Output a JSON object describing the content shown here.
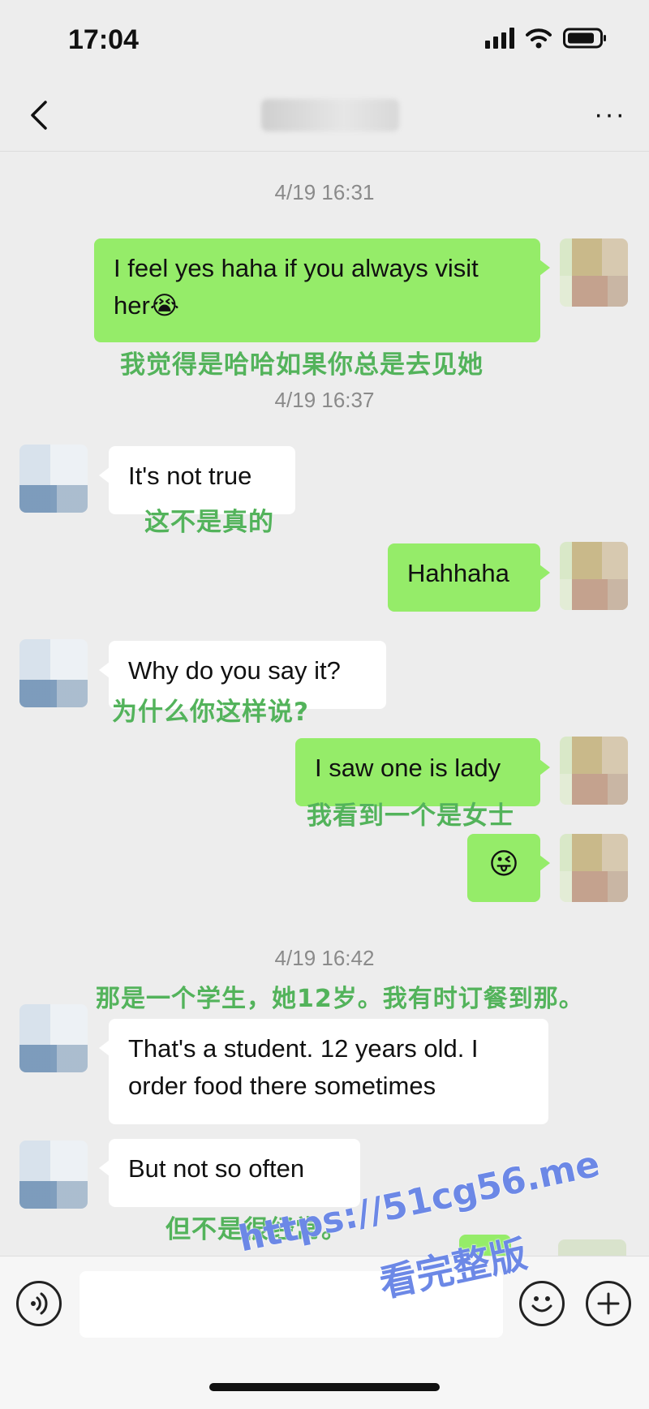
{
  "status": {
    "time": "17:04"
  },
  "nav": {
    "back_icon": "chevron-left-icon",
    "more_label": "···"
  },
  "messages": [
    {
      "timestamp": "4/19 16:31"
    },
    {
      "side": "right",
      "text_line1": "I feel yes haha if you always visit",
      "text_line2": "her😭",
      "translation": "我觉得是哈哈如果你总是去见她"
    },
    {
      "timestamp": "4/19 16:37"
    },
    {
      "side": "left",
      "text": "It's not true",
      "translation": "这不是真的"
    },
    {
      "side": "right",
      "text": "Hahhaha"
    },
    {
      "side": "left",
      "text": "Why do you say it?",
      "translation": "为什么你这样说?"
    },
    {
      "side": "right",
      "text": "I saw one is lady",
      "translation": "我看到一个是女士"
    },
    {
      "side": "right",
      "text": "😜"
    },
    {
      "timestamp": "4/19 16:42"
    },
    {
      "side": "left",
      "translation": "那是一个学生，她12岁。我有时订餐到那。",
      "text_line1": "That's a student. 12 years old. I",
      "text_line2": "order food there sometimes"
    },
    {
      "side": "left",
      "text": "But not so often",
      "translation": "但不是很经常。"
    }
  ],
  "watermark": {
    "line1": "https://51cg56.me",
    "line2": "看完整版"
  }
}
